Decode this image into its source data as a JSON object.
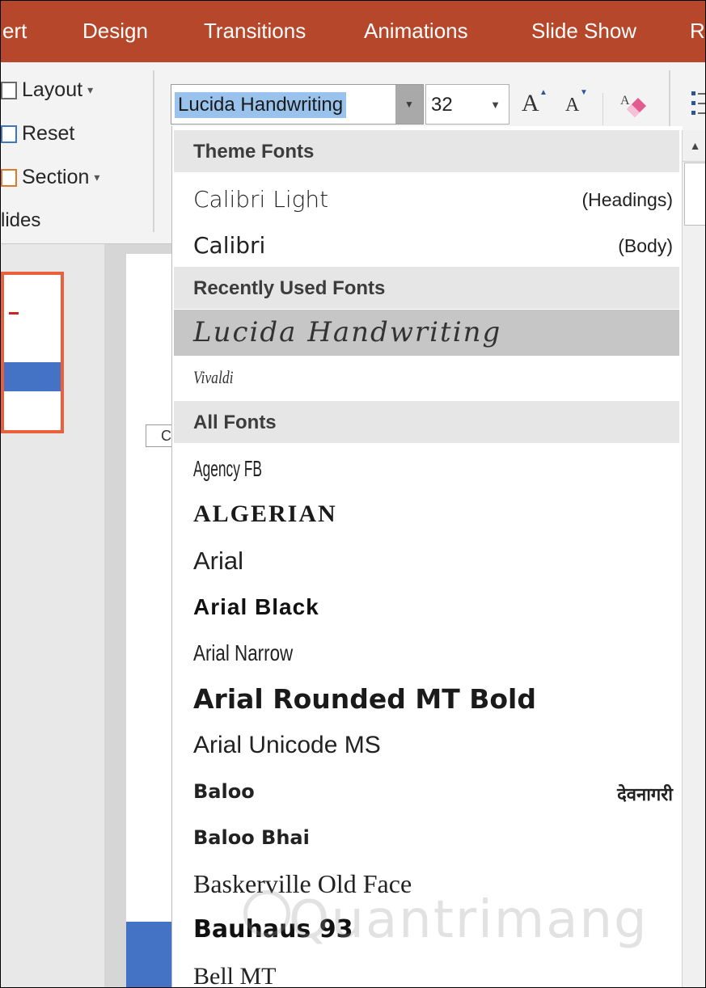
{
  "tabs": [
    "ert",
    "Design",
    "Transitions",
    "Animations",
    "Slide Show",
    "R"
  ],
  "slides_group": {
    "layout_label": "Layout",
    "reset_label": "Reset",
    "section_label": "Section",
    "group_label": "lides"
  },
  "font_name_box": {
    "value": "Lucida Handwriting"
  },
  "font_size_box": {
    "value": "32"
  },
  "grow_font_label": "A",
  "shrink_font_label": "A",
  "slide_placeholder_text": "C",
  "dropdown": {
    "theme_fonts_header": "Theme Fonts",
    "theme_fonts": [
      {
        "name": "Calibri Light",
        "tag": "(Headings)"
      },
      {
        "name": "Calibri",
        "tag": "(Body)"
      }
    ],
    "recent_header": "Recently Used Fonts",
    "recent_fonts": [
      "Lucida Handwriting",
      "Vivaldi"
    ],
    "all_header": "All Fonts",
    "all_fonts": [
      {
        "name": "Agency FB"
      },
      {
        "name": "ALGERIAN"
      },
      {
        "name": "Arial"
      },
      {
        "name": "Arial Black"
      },
      {
        "name": "Arial Narrow"
      },
      {
        "name": "Arial Rounded MT Bold"
      },
      {
        "name": "Arial Unicode MS"
      },
      {
        "name": "Baloo",
        "tag": "देवनागरी"
      },
      {
        "name": "Baloo Bhai"
      },
      {
        "name": "Baskerville Old Face"
      },
      {
        "name": "Bauhaus 93"
      },
      {
        "name": "Bell MT"
      }
    ]
  },
  "watermark": "Quantrimang",
  "colors": {
    "ribbon_tab_bg": "#b7472a",
    "selection_highlight": "#99c3ec",
    "hover_item_bg": "#c6c6c6",
    "section_header_bg": "#e6e6e6",
    "accent_blue": "#4472c4",
    "thumbnail_border": "#e8603c"
  }
}
